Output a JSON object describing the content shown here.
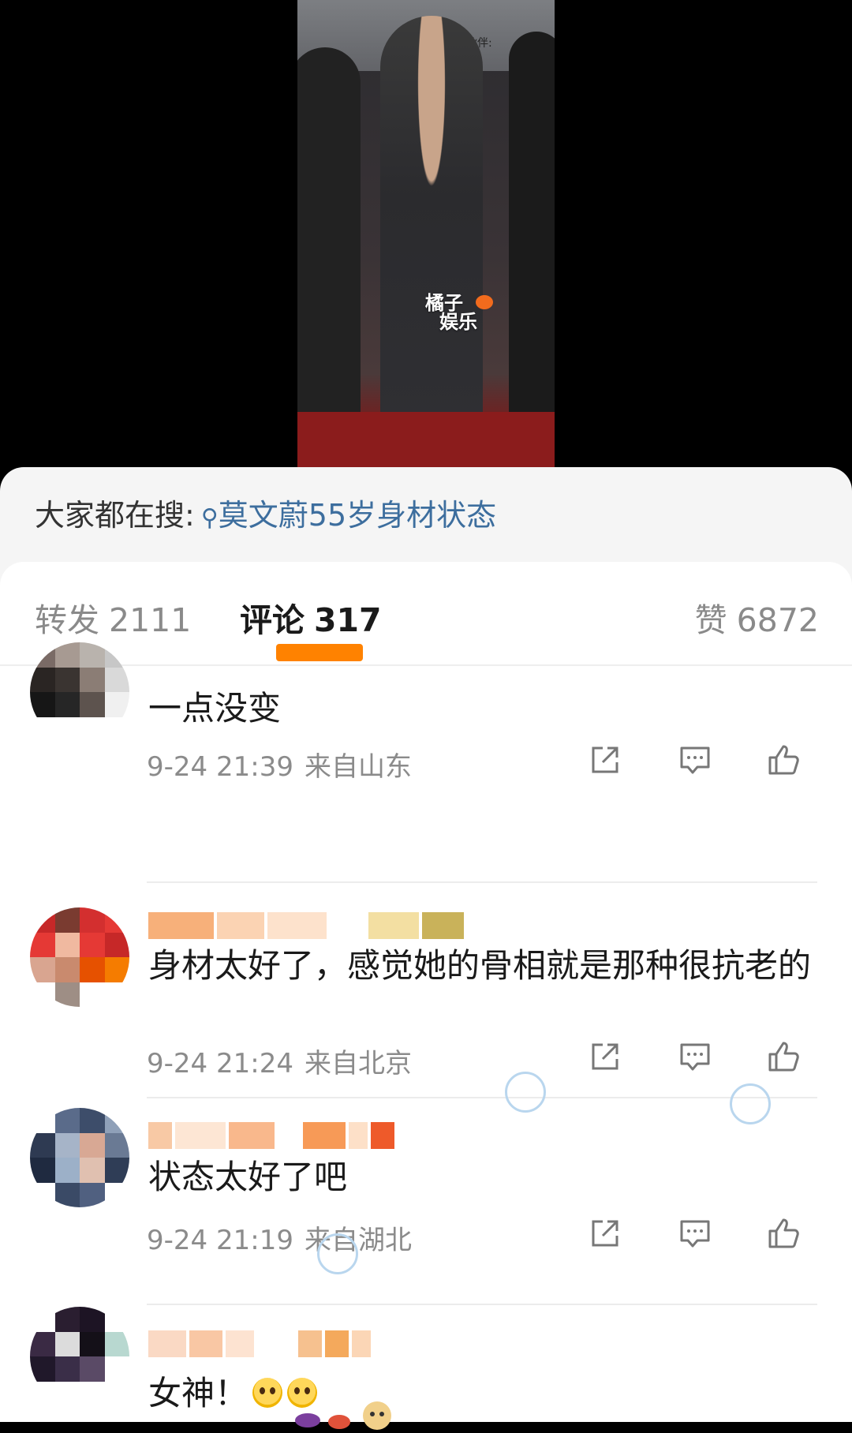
{
  "video": {
    "watermark_line1": "橘子",
    "watermark_line2": "娱乐",
    "sponsor_text": "作伙伴:"
  },
  "hot_search": {
    "prefix": "大家都在搜:",
    "keyword": "莫文蔚55岁身材状态"
  },
  "tabs": {
    "repost_label": "转发",
    "repost_count": "2111",
    "comment_label": "评论",
    "comment_count": "317",
    "like_label": "赞",
    "like_count": "6872"
  },
  "comments": [
    {
      "text": "一点没变",
      "time": "9-24 21:39",
      "source": "来自山东"
    },
    {
      "text": "身材太好了，感觉她的骨相就是那种很抗老的",
      "time": "9-24 21:24",
      "source": "来自北京"
    },
    {
      "text": "状态太好了吧",
      "time": "9-24 21:19",
      "source": "来自湖北"
    },
    {
      "text": "女神！",
      "time": "",
      "source": ""
    }
  ],
  "icons": {
    "share": "share-icon",
    "reply": "comment-icon",
    "like": "thumbs-up-icon",
    "search": "search-icon"
  },
  "colors": {
    "accent": "#ff8200",
    "link": "#3d6e9e",
    "muted": "#8b8b8b"
  }
}
